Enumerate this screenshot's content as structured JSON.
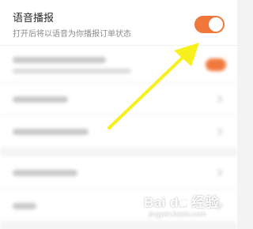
{
  "voice_setting": {
    "title": "语音播报",
    "description": "打开后将以语音为你播报订单状态",
    "enabled": true
  },
  "colors": {
    "toggle_on": "#f0763a",
    "arrow": "#f7f01c"
  },
  "watermark": {
    "logo_text": "Bai du 经验",
    "sub_text": "jingyan.baidu.com"
  }
}
